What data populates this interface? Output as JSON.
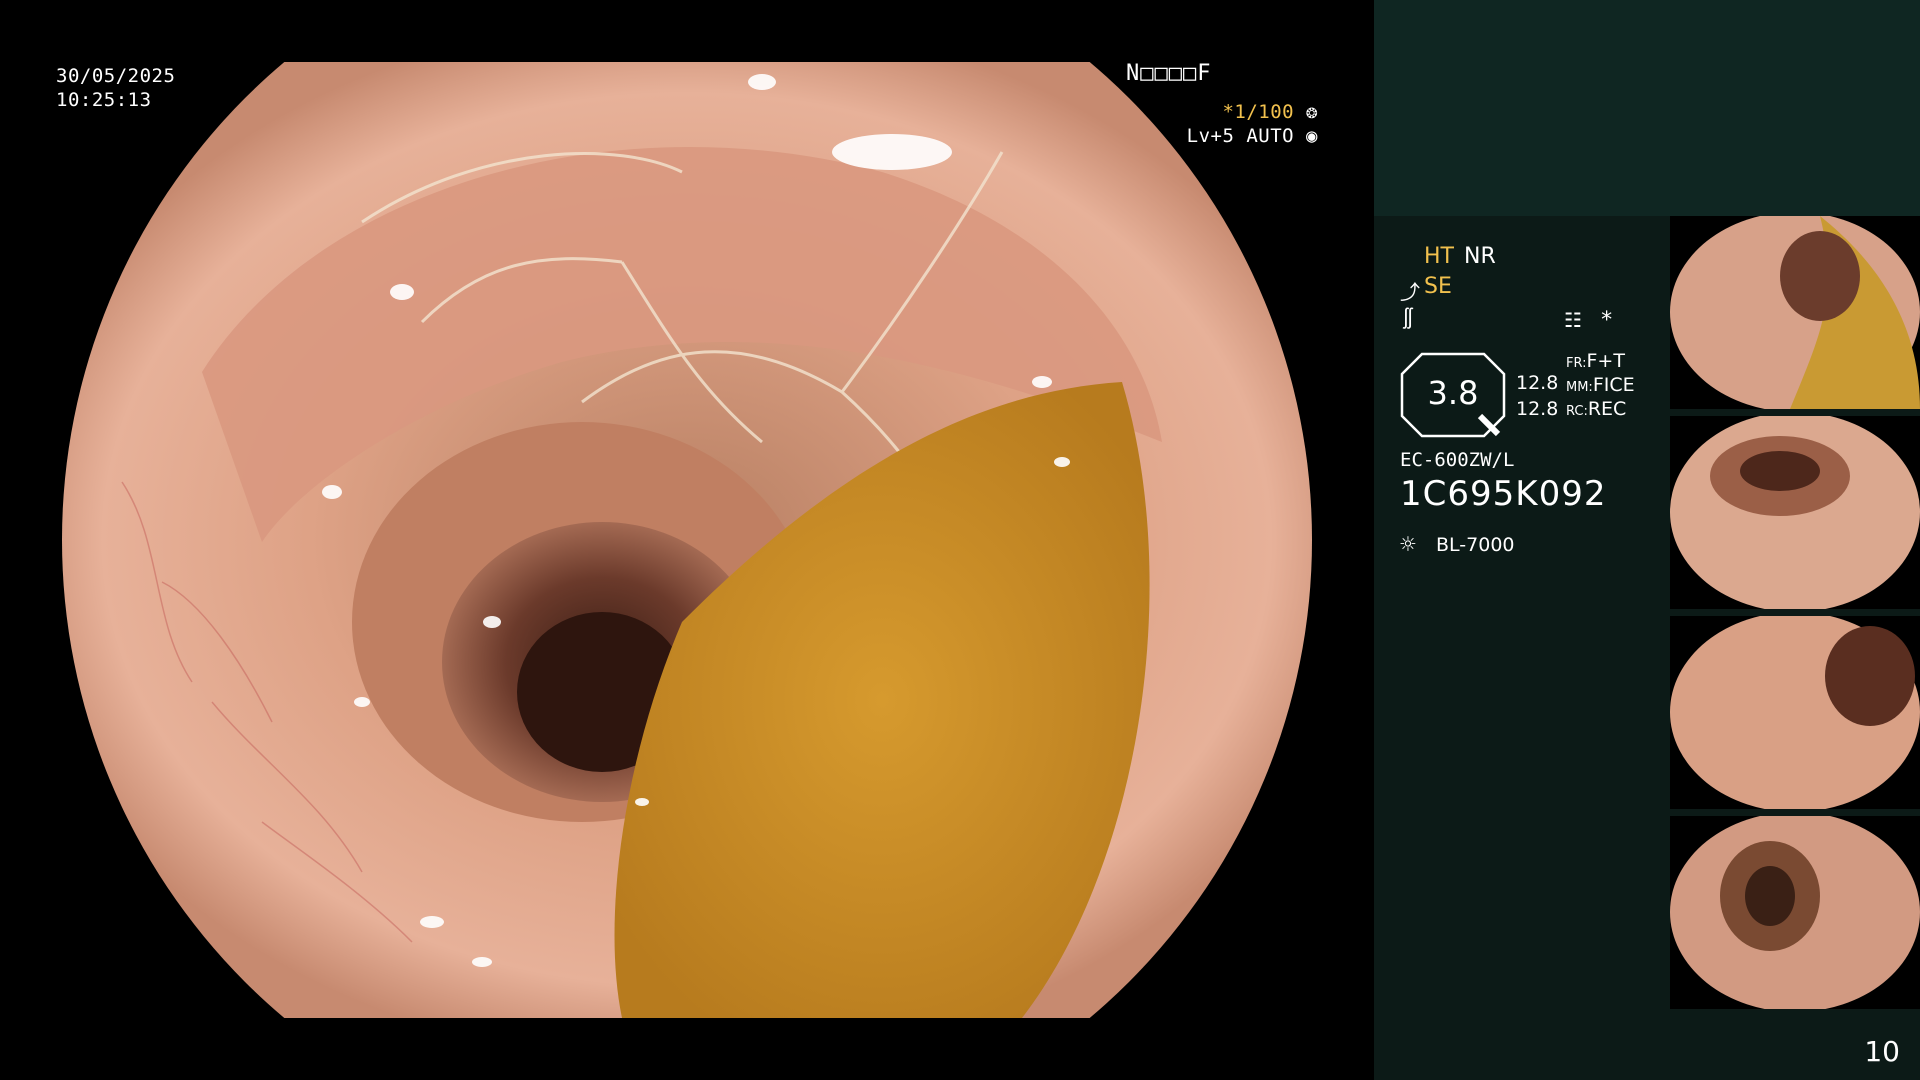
{
  "osd": {
    "date": "30/05/2025",
    "time": "10:25:13",
    "patient_code": "N□□□□F",
    "shutter": "*1/100",
    "level": "Lv+5 AUTO"
  },
  "panel": {
    "ht": "HT",
    "nr": "NR",
    "se": "SE",
    "star": "*",
    "zoom": "3.8",
    "value1": "12.8",
    "value2": "12.8",
    "fr_label": "FR:",
    "fr_value": "F+T",
    "mm_label": "MM:",
    "mm_value": "FICE",
    "rc_label": "RC:",
    "rc_value": "REC",
    "scope_model": "EC-600ZW/L",
    "scope_serial": "1C695K092",
    "light_source": "BL-7000",
    "page_number": "10"
  },
  "colors": {
    "accent_yellow": "#f2c14e",
    "panel_bg": "#0c1a17",
    "panel_top_bg": "#0f2622"
  }
}
